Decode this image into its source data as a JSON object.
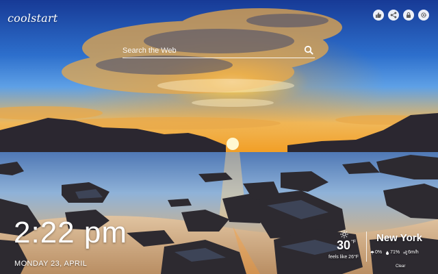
{
  "app": {
    "logo_text": "coolstart"
  },
  "toolbar": {
    "buttons": [
      {
        "icon": "thumbs-up-icon"
      },
      {
        "icon": "share-icon"
      },
      {
        "icon": "lock-icon"
      },
      {
        "icon": "gear-icon"
      }
    ]
  },
  "search": {
    "placeholder": "Search the Web",
    "icon": "search-icon"
  },
  "clock": {
    "time": "2:22 pm",
    "date": "MONDAY 23, APRIL"
  },
  "weather": {
    "icon": "sun-icon",
    "temperature": "30",
    "unit": "°F",
    "feels_like": "feels like 26°F",
    "city": "New York",
    "precipitation": "0%",
    "humidity": "71%",
    "wind": "6m/h",
    "condition": "Clear"
  },
  "colors": {
    "sky_top": "#1a3f9c",
    "sky_mid": "#3f86d8",
    "sunset": "#f6a21a",
    "sun": "#ffe68a",
    "water": "#6a8fb8",
    "rock": "#2d2a30"
  }
}
